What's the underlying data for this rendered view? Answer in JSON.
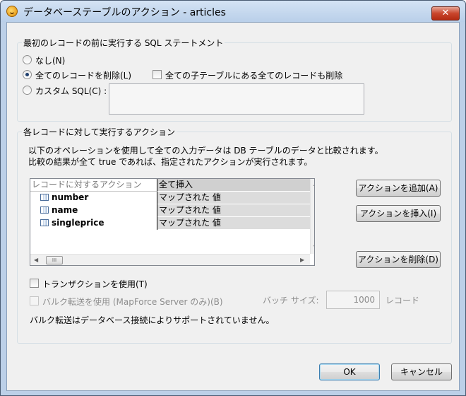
{
  "window": {
    "title": "データベーステーブルのアクション - articles",
    "close_glyph": "✕"
  },
  "pre_statement": {
    "group_label": "最初のレコードの前に実行する SQL ステートメント",
    "options": [
      {
        "label": "なし(N)",
        "checked": false
      },
      {
        "label": "全てのレコードを削除(L)",
        "checked": true
      },
      {
        "label": "カスタム SQL(C) :",
        "checked": false
      }
    ],
    "delete_child_label": "全ての子テーブルにある全てのレコードも削除",
    "delete_child_checked": false,
    "custom_sql_value": ""
  },
  "actions": {
    "group_label": "各レコードに対して実行するアクション",
    "description_line1": "以下のオペレーションを使用して全ての入力データは DB テーブルのデータと比較されます。",
    "description_line2": "比較の結果が全て true であれば、指定されたアクションが実行されます。",
    "grid": {
      "header_col1": "レコードに対するアクション",
      "header_col2": "全て挿入",
      "rows": [
        {
          "field": "number",
          "mapping": "マップされた 値"
        },
        {
          "field": "name",
          "mapping": "マップされた 値"
        },
        {
          "field": "singleprice",
          "mapping": "マップされた 値"
        }
      ],
      "hscroll_thumb_glyph": "III"
    },
    "add_button": "アクションを追加(A)",
    "insert_button": "アクションを挿入(I)",
    "delete_button": "アクションを削除(D)"
  },
  "transaction": {
    "label": "トランザクションを使用(T)",
    "checked": false
  },
  "bulk": {
    "label": "バルク転送を使用 (MapForce Server のみ)(B)",
    "batch_size_label": "バッチ サイズ:",
    "batch_size_value": "1000",
    "records_label": "レコード",
    "note": "バルク転送はデータベース接続によりサポートされていません。"
  },
  "footer": {
    "ok_label": "OK",
    "cancel_label": "キャンセル"
  }
}
